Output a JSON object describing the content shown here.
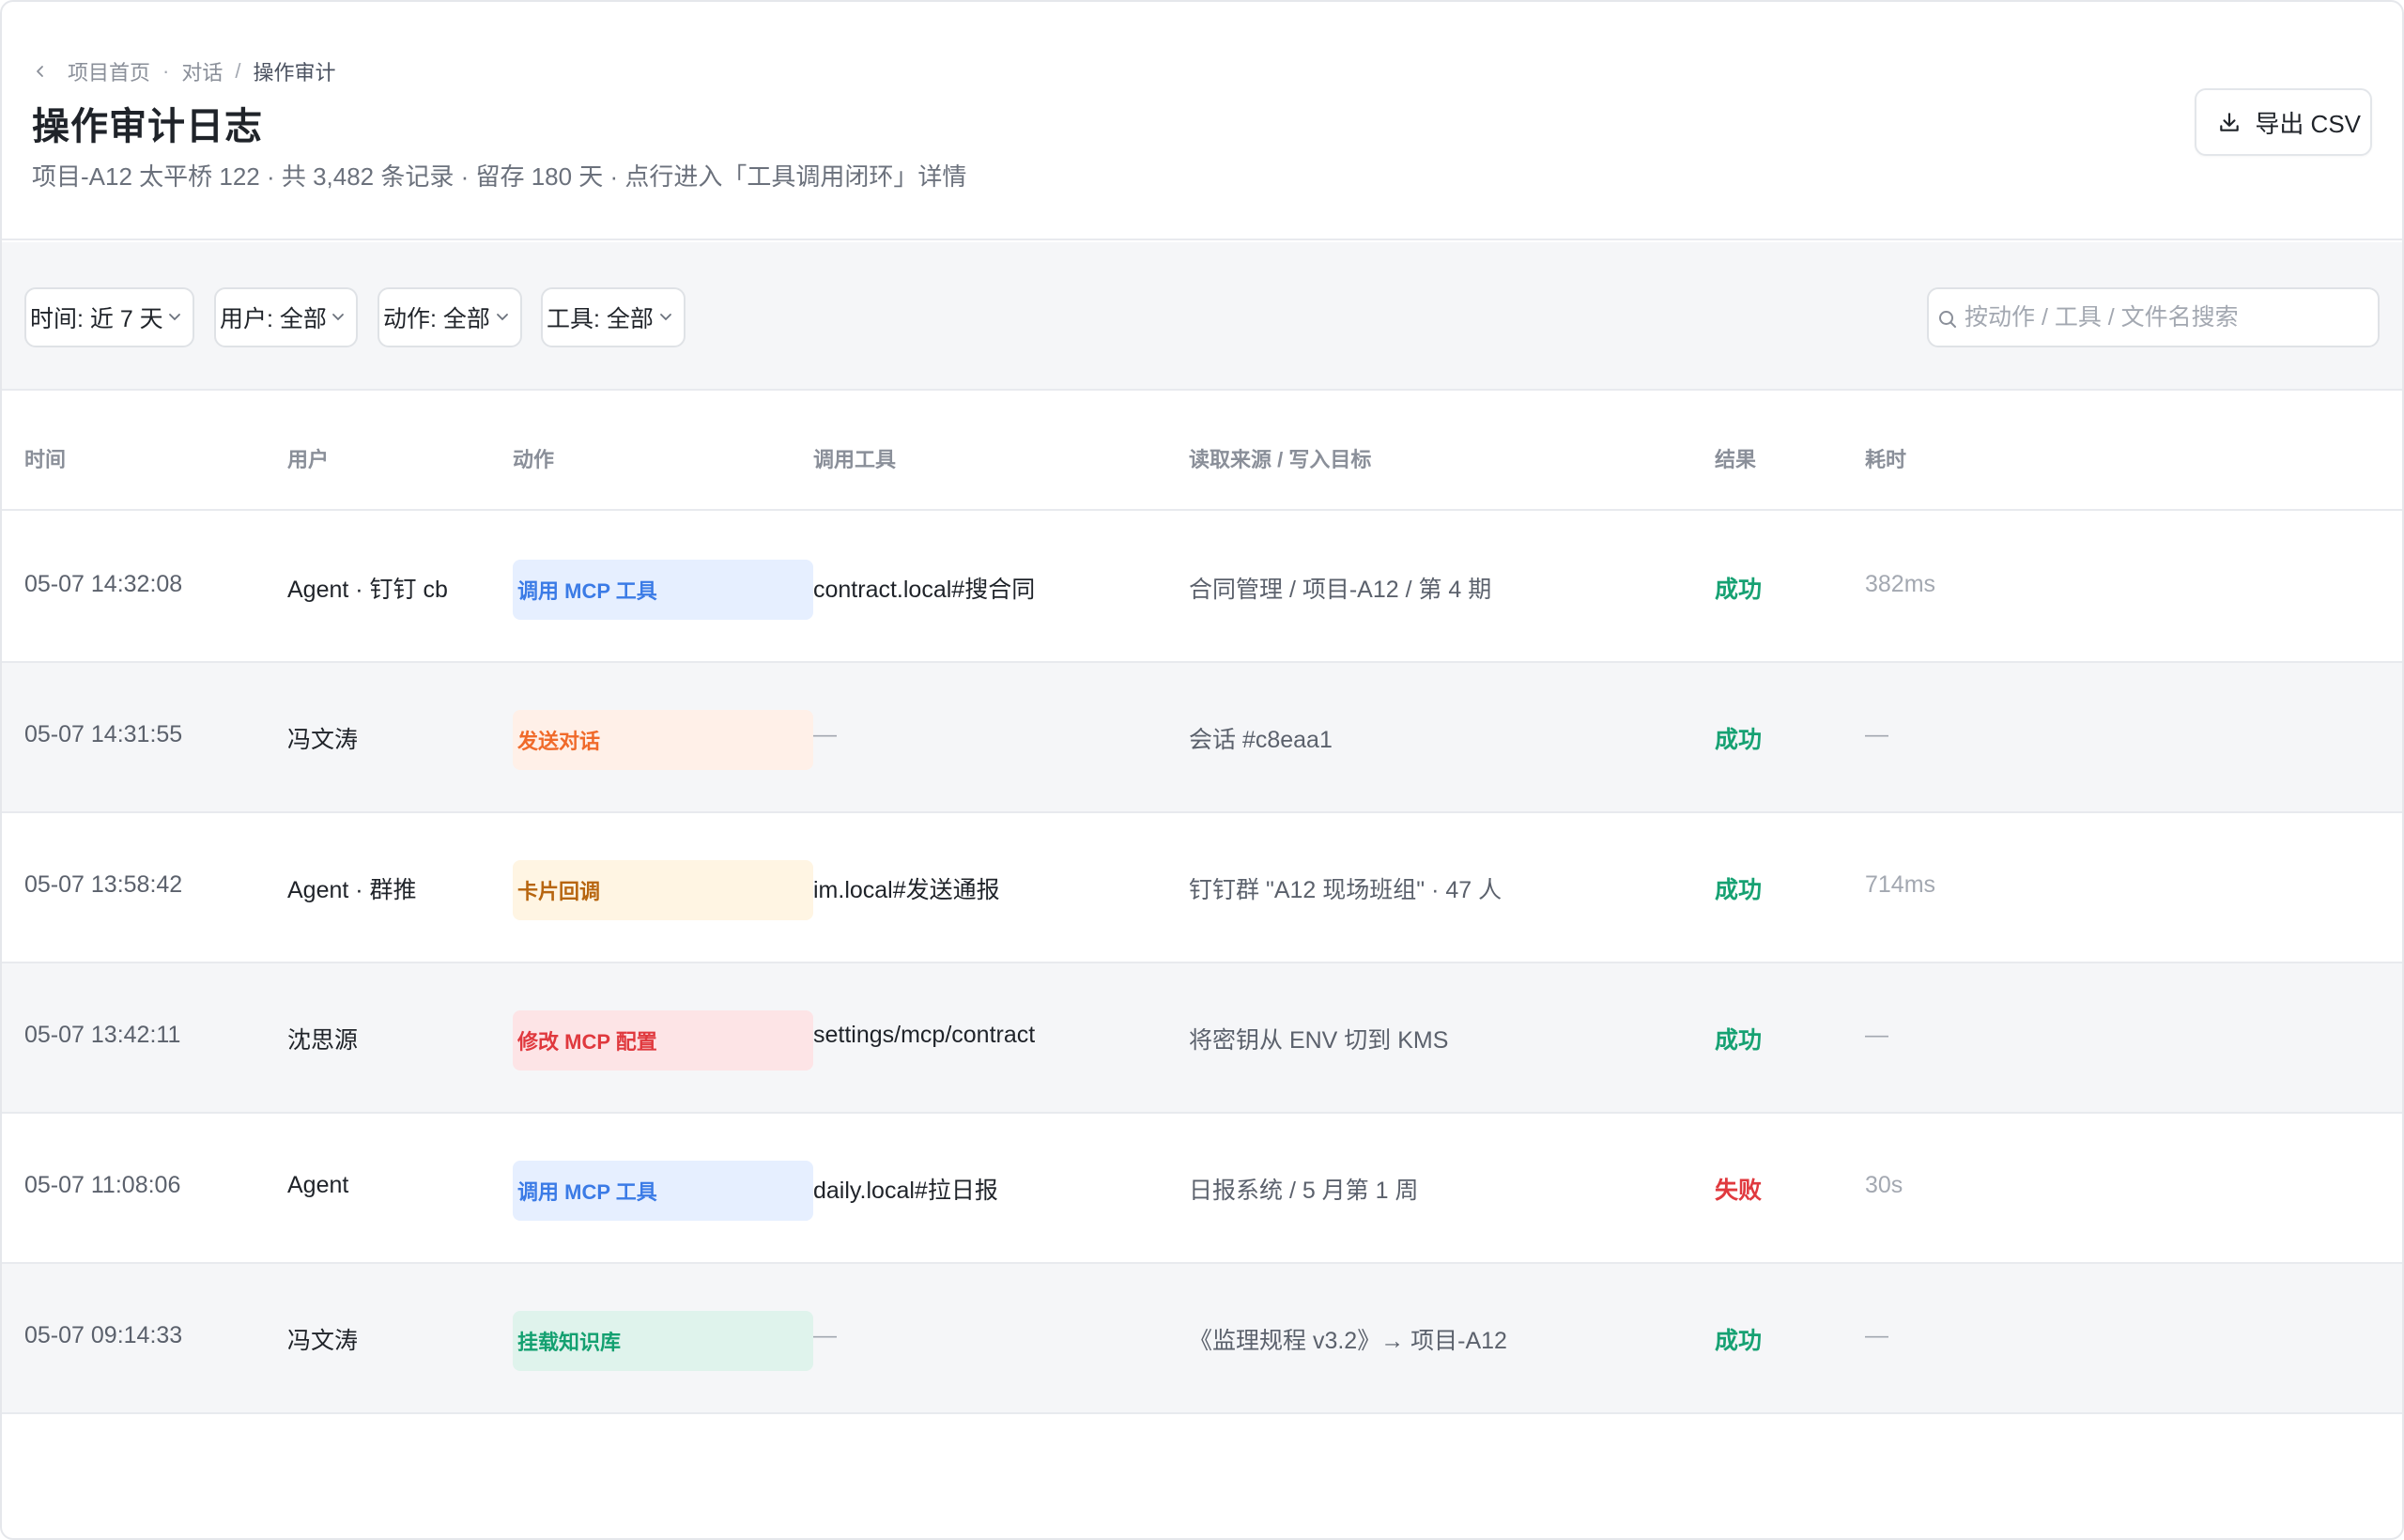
{
  "breadcrumb": {
    "items": [
      "项目首页",
      "对话",
      "操作审计"
    ],
    "separators": [
      "·",
      "/"
    ]
  },
  "page": {
    "title": "操作审计日志",
    "subtitle": "项目-A12 太平桥 122 · 共 3,482 条记录 · 留存 180 天 · 点行进入「工具调用闭环」详情"
  },
  "toolbar": {
    "export_label": "导出 CSV"
  },
  "filters": {
    "time": "时间: 近 7 天",
    "user": "用户: 全部",
    "action": "动作: 全部",
    "tool": "工具: 全部"
  },
  "search": {
    "placeholder": "按动作 / 工具 / 文件名搜索"
  },
  "table": {
    "headers": [
      "时间",
      "用户",
      "动作",
      "调用工具",
      "读取来源 / 写入目标",
      "结果",
      "耗时"
    ],
    "rows": [
      {
        "time": "05-07 14:32:08",
        "user": "Agent · 钉钉 cb",
        "action": "调用 MCP 工具",
        "tool": "contract.local#搜合同",
        "source": "合同管理 / 项目-A12 / 第 4 期",
        "result": "成功",
        "duration": "382ms"
      },
      {
        "time": "05-07 14:31:55",
        "user": "冯文涛",
        "action": "发送对话",
        "tool": "—",
        "source": "会话 #c8eaa1",
        "result": "成功",
        "duration": "—"
      },
      {
        "time": "05-07 13:58:42",
        "user": "Agent · 群推",
        "action": "卡片回调",
        "tool": "im.local#发送通报",
        "source": "钉钉群 \"A12 现场班组\" · 47 人",
        "result": "成功",
        "duration": "714ms"
      },
      {
        "time": "05-07 13:42:11",
        "user": "沈思源",
        "action": "修改 MCP 配置",
        "tool": "settings/mcp/contract",
        "source": "将密钥从 ENV 切到 KMS",
        "result": "成功",
        "duration": "—"
      },
      {
        "time": "05-07 11:08:06",
        "user": "Agent",
        "action": "调用 MCP 工具",
        "tool": "daily.local#拉日报",
        "source": "日报系统 / 5 月第 1 周",
        "result": "失败",
        "duration": "30s"
      },
      {
        "time": "05-07 09:14:33",
        "user": "冯文涛",
        "action": "挂载知识库",
        "tool": "—",
        "source": "《监理规程 v3.2》→ 项目-A12",
        "result": "成功",
        "duration": "—"
      }
    ]
  },
  "colors": {
    "success": "#16a172",
    "fail": "#e0393e",
    "badge_blue": {
      "bg": "#e6efff",
      "fg": "#3b7be6"
    },
    "badge_orange": {
      "bg": "#fff0e8",
      "fg": "#f06a2a"
    },
    "badge_amber": {
      "bg": "#fff5e3",
      "fg": "#b7650f"
    },
    "badge_red": {
      "bg": "#fde4e6",
      "fg": "#e0393e"
    },
    "badge_green": {
      "bg": "#dff3ec",
      "fg": "#13a070"
    }
  }
}
